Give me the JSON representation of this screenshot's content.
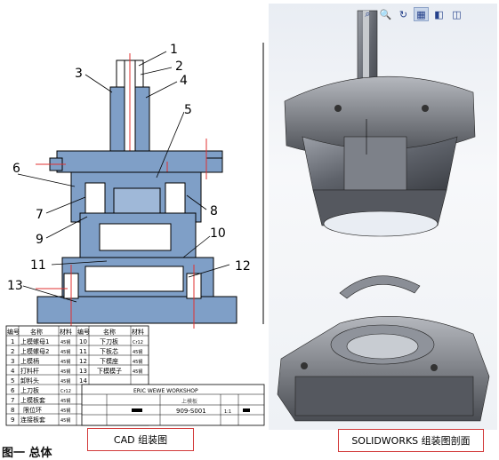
{
  "cad": {
    "callouts": [
      "1",
      "2",
      "3",
      "4",
      "5",
      "6",
      "7",
      "8",
      "9",
      "10",
      "11",
      "12",
      "13"
    ],
    "parts_table": {
      "headers": [
        "编号",
        "名称",
        "材料",
        "编号",
        "名称",
        "材料"
      ],
      "rows": [
        [
          "1",
          "上模螺母1",
          "45钢",
          "10",
          "下刀板",
          "Cr12"
        ],
        [
          "2",
          "上模螺母2",
          "45钢",
          "11",
          "下板芯",
          "45钢"
        ],
        [
          "3",
          "上模柄",
          "45钢",
          "12",
          "下模座",
          "45钢"
        ],
        [
          "4",
          "打料杆",
          "45钢",
          "13",
          "下模模子",
          "45钢"
        ],
        [
          "5",
          "卸料头",
          "45钢",
          "14",
          "",
          ""
        ],
        [
          "6",
          "上刀板",
          "Cr12",
          "",
          "",
          " "
        ],
        [
          "7",
          "上模板套",
          "45钢",
          "",
          "",
          ""
        ],
        [
          "8",
          "限位环",
          "45钢",
          "",
          "",
          ""
        ],
        [
          "9",
          "连接板套",
          "45钢",
          "",
          "",
          ""
        ]
      ]
    },
    "title_block": {
      "workshop": "ERIC WEWE WORKSHOP",
      "part_name": "上模板",
      "drawing_no": "909-S001",
      "scale": "1:1"
    }
  },
  "solidworks": {
    "toolbar_icons": [
      "zoom-fit-icon",
      "zoom-area-icon",
      "rotate-icon",
      "section-view-icon",
      "display-style-icon",
      "hide-show-icon"
    ]
  },
  "captions": {
    "cad": "CAD 组装图",
    "solidworks": "SOLIDWORKS 组装图剖面"
  },
  "footer": "图一 总体"
}
